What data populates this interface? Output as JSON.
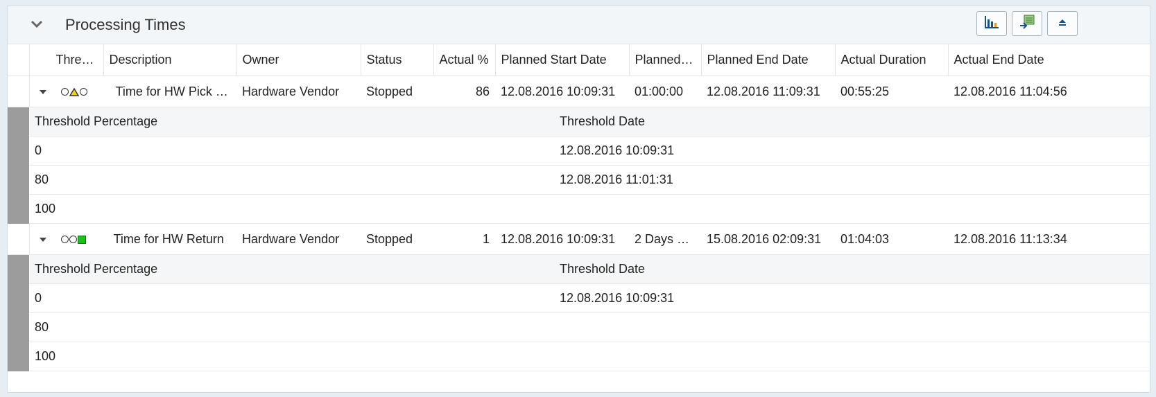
{
  "panel": {
    "title": "Processing Times",
    "toolbar": {
      "chart_icon": "bar-chart-icon",
      "export_icon": "export-icon",
      "collapse_icon": "eject-icon"
    }
  },
  "columns": [
    "Thre…",
    "Description",
    "Owner",
    "Status",
    "Actual %",
    "Planned Start Date",
    "Planned…",
    "Planned End Date",
    "Actual Duration",
    "Actual End Date"
  ],
  "rows": [
    {
      "lights": [
        "empty-circle",
        "yellow-triangle",
        "empty-circle"
      ],
      "description": "Time for HW Pick Up",
      "owner": "Hardware Vendor",
      "status": "Stopped",
      "actual_pct": "86",
      "planned_start": "12.08.2016 10:09:31",
      "planned_duration": "01:00:00",
      "planned_end": "12.08.2016 11:09:31",
      "actual_duration": "00:55:25",
      "actual_end": "12.08.2016 11:04:56",
      "sub": {
        "headers": [
          "Threshold Percentage",
          "Threshold Date"
        ],
        "rows": [
          [
            "0",
            "12.08.2016 10:09:31"
          ],
          [
            "80",
            "12.08.2016 11:01:31"
          ],
          [
            "100",
            ""
          ]
        ]
      }
    },
    {
      "lights": [
        "empty-circle",
        "empty-circle",
        "green-square"
      ],
      "description": "Time for HW Return",
      "owner": "Hardware Vendor",
      "status": "Stopped",
      "actual_pct": "1",
      "planned_start": "12.08.2016 10:09:31",
      "planned_duration": "2 Days …",
      "planned_end": "15.08.2016 02:09:31",
      "actual_duration": "01:04:03",
      "actual_end": "12.08.2016 11:13:34",
      "sub": {
        "headers": [
          "Threshold Percentage",
          "Threshold Date"
        ],
        "rows": [
          [
            "0",
            "12.08.2016 10:09:31"
          ],
          [
            "80",
            ""
          ],
          [
            "100",
            ""
          ]
        ]
      }
    }
  ],
  "colors": {
    "yellow_light": "#f2d21b",
    "green_light": "#18c218",
    "detail_bar": "#9c9c9c"
  }
}
